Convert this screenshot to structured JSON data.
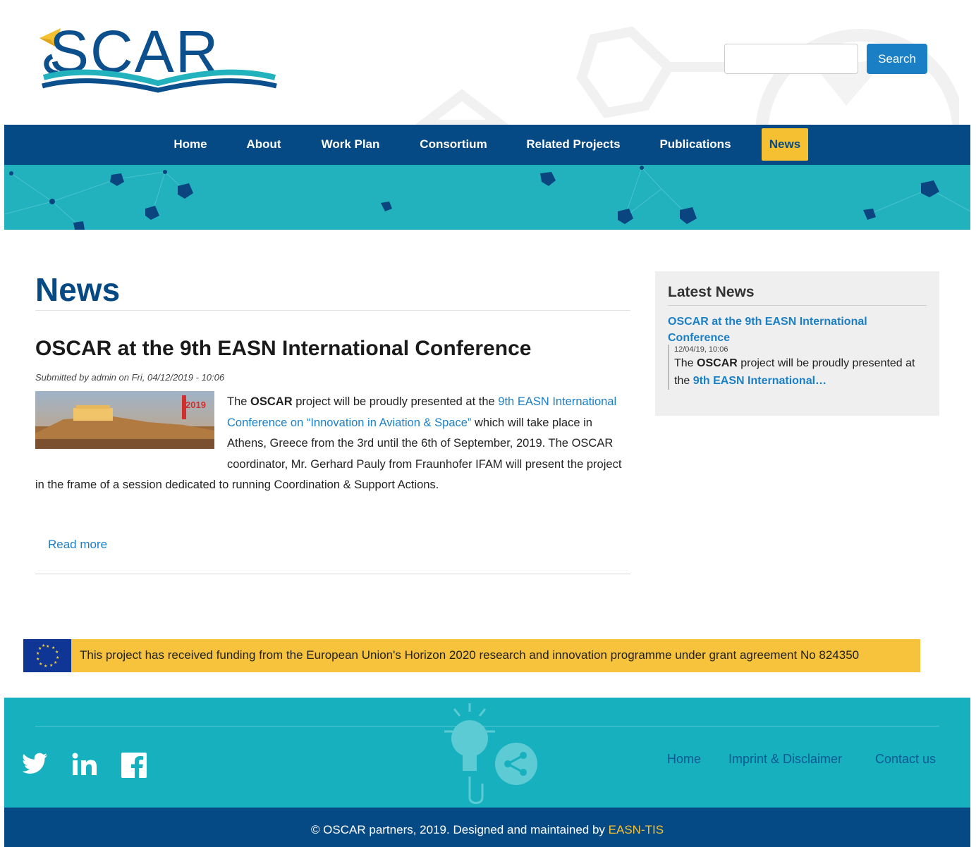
{
  "header": {
    "logo_text": "OSCAR",
    "search_placeholder": "",
    "search_button": "Search"
  },
  "nav": {
    "items": [
      {
        "label": "Home",
        "active": false
      },
      {
        "label": "About",
        "active": false
      },
      {
        "label": "Work Plan",
        "active": false
      },
      {
        "label": "Consortium",
        "active": false
      },
      {
        "label": "Related Projects",
        "active": false
      },
      {
        "label": "Publications",
        "active": false
      },
      {
        "label": "News",
        "active": true
      }
    ]
  },
  "main": {
    "page_title": "News",
    "article": {
      "title": "OSCAR at the 9th EASN International Conference",
      "submitted": "Submitted by admin on Fri, 04/12/2019 - 10:06",
      "thumb_year": "2019",
      "body_intro": "The ",
      "body_bold": "OSCAR",
      "body_mid": " project will be proudly presented at the ",
      "body_link": "9th EASN International Conference on “Innovation in Aviation & Space”",
      "body_rest": " which will take place in Athens, Greece from the 3rd until the 6th of September, 2019. The OSCAR coordinator, Mr. Gerhard Pauly from Fraunhofer IFAM will present the project in the frame of a session dedicated to running Coordination & Support Actions.",
      "read_more": "Read more"
    }
  },
  "sidebar": {
    "title": "Latest News",
    "item_link": "OSCAR at the 9th EASN International Conference",
    "item_date": "12/04/19, 10:06",
    "teaser_pre": "The ",
    "teaser_bold": "OSCAR",
    "teaser_mid": " project will be proudly presented at the ",
    "teaser_link": "9th EASN International…"
  },
  "funding": {
    "text": "This project has received funding from the European Union's Horizon 2020 research and innovation programme under grant agreement No 824350"
  },
  "footer": {
    "social": [
      "twitter-icon",
      "linkedin-icon",
      "facebook-icon"
    ],
    "links": [
      "Home",
      "Imprint & Disclaimer",
      "Contact us"
    ],
    "copyright_pre": "© OSCAR partners, 2019. Designed and maintained by ",
    "copyright_brand": "EASN-TIS"
  },
  "colors": {
    "primary": "#064a85",
    "accent": "#f5c133",
    "teal": "#21b2bd",
    "link": "#1b7fc6"
  }
}
